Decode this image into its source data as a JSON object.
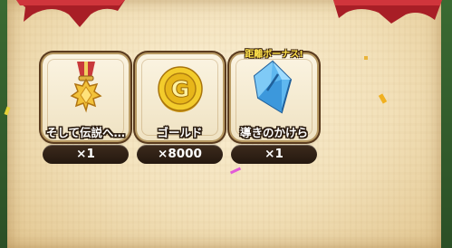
{
  "rewards": [
    {
      "name": "そして伝説へ…",
      "quantity": "×1",
      "icon": "medal-icon"
    },
    {
      "name": "ゴールド",
      "quantity": "×8000",
      "icon": "gold-coin-icon"
    },
    {
      "name": "導きのかけら",
      "quantity": "×1",
      "icon": "crystal-shard-icon",
      "badge": "距離ボーナス!"
    }
  ],
  "colors": {
    "parchment": "#f2e0b8",
    "ribbon": "#b8222a",
    "quantity_pill": "#2a1c12",
    "badge_text": "#ffe24a"
  }
}
